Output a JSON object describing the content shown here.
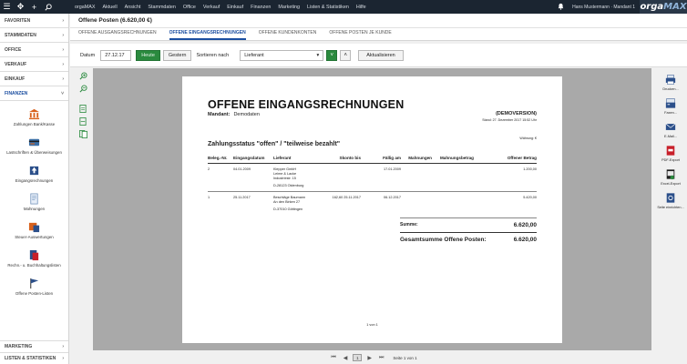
{
  "topbar": {
    "menu": [
      "orgaMAX",
      "Aktuell",
      "Ansicht",
      "Stammdaten",
      "Office",
      "Verkauf",
      "Einkauf",
      "Finanzen",
      "Marketing",
      "Listen & Statistiken",
      "Hilfe"
    ],
    "user": "Hans Mustermann · Mandant 1",
    "logo_main": "orga",
    "logo_accent": "MAX"
  },
  "sidebar": {
    "sections": [
      {
        "label": "FAVORITEN",
        "chev": "›"
      },
      {
        "label": "STAMMDATEN",
        "chev": "›"
      },
      {
        "label": "OFFICE",
        "chev": "›"
      },
      {
        "label": "VERKAUF",
        "chev": "›"
      },
      {
        "label": "EINKAUF",
        "chev": "›"
      }
    ],
    "active": {
      "label": "FINANZEN",
      "chev": "˅"
    },
    "items": [
      {
        "label": "Zahlungen Bank/Kasse",
        "icon": "bank-icon"
      },
      {
        "label": "Lastschriften & Überweisungen",
        "icon": "card-icon"
      },
      {
        "label": "Eingangsrechnungen",
        "icon": "inbox-icon"
      },
      {
        "label": "Mahnungen",
        "icon": "reminder-icon"
      },
      {
        "label": "Steuer-Auswertungen",
        "icon": "tax-icon"
      },
      {
        "label": "Rechn.- u. Buchhaltungslisten",
        "icon": "ledger-icon"
      },
      {
        "label": "Offene Posten-Listen",
        "icon": "flag-icon"
      }
    ],
    "bottom": [
      {
        "label": "MARKETING",
        "chev": "›"
      },
      {
        "label": "LISTEN & STATISTIKEN",
        "chev": "›"
      }
    ]
  },
  "header": {
    "title": "Offene Posten (6.620,00 €)"
  },
  "tabs": [
    {
      "label": "OFFENE AUSGANGSRECHNUNGEN",
      "active": false
    },
    {
      "label": "OFFENE EINGANGSRECHNUNGEN",
      "active": true
    },
    {
      "label": "OFFENE KUNDENKONTEN",
      "active": false
    },
    {
      "label": "OFFENE POSTEN JE KUNDE",
      "active": false
    }
  ],
  "filter": {
    "datum_label": "Datum",
    "datum_value": "27.12.17",
    "heute": "Heute",
    "gestern": "Gestern",
    "sort_label": "Sortieren nach",
    "sort_value": "Lieferant",
    "refresh": "Aktualisieren"
  },
  "report": {
    "title": "OFFENE EINGANGSRECHNUNGEN",
    "mandant_label": "Mandant:",
    "mandant_value": "Demodaten",
    "demo": "(DEMOVERSION)",
    "stand": "Stand: 27. Dezember 2017 15:52 Uhr",
    "waehrung": "Währung: €",
    "status": "Zahlungsstatus \"offen\" / \"teilweise bezahlt\"",
    "columns": [
      "Beleg.-Nr.",
      "Eingangsdatum",
      "Lieferant",
      "Skonto bis",
      "Fällig am",
      "Mahnungen",
      "Mahnungsbetrag",
      "Offener Betrag"
    ],
    "rows": [
      {
        "beleg": "2",
        "datum": "04.01.2009",
        "lieferant": [
          "Klepper GmbH",
          "Leime & Lacke",
          "Industriestr. 15",
          "",
          "D-28123 Oldenburg"
        ],
        "skonto_betrag": "",
        "skonto_bis": "",
        "faellig": "17.01.2009",
        "mahnungen": "",
        "mahnbetrag": "",
        "offen": "1.200,00"
      },
      {
        "beleg": "1",
        "datum": "25.11.2017",
        "lieferant": [
          "Beschläge Baumann",
          "An den Birken 27",
          "",
          "D-37010 Göttingen"
        ],
        "skonto_betrag": "162,60",
        "skonto_bis": "25.11.2017",
        "faellig": "06.12.2017",
        "mahnungen": "",
        "mahnbetrag": "",
        "offen": "5.420,00"
      }
    ],
    "summe_label": "Summe:",
    "summe_value": "6.620,00",
    "gesamt_label": "Gesamtsumme Offene Posten:",
    "gesamt_value": "6.620,00",
    "page_of": "1 von 1"
  },
  "righttools": [
    {
      "label": "Drucken...",
      "icon": "printer-icon"
    },
    {
      "label": "Faxen...",
      "icon": "fax-icon"
    },
    {
      "label": "E-Mail...",
      "icon": "email-icon"
    },
    {
      "label": "PDF-Export",
      "icon": "pdf-icon"
    },
    {
      "label": "Excel-Export",
      "icon": "excel-icon"
    },
    {
      "label": "Seite einrichten...",
      "icon": "page-setup-icon"
    }
  ],
  "pager": {
    "page": "1",
    "info": "Seite 1 von 1"
  }
}
